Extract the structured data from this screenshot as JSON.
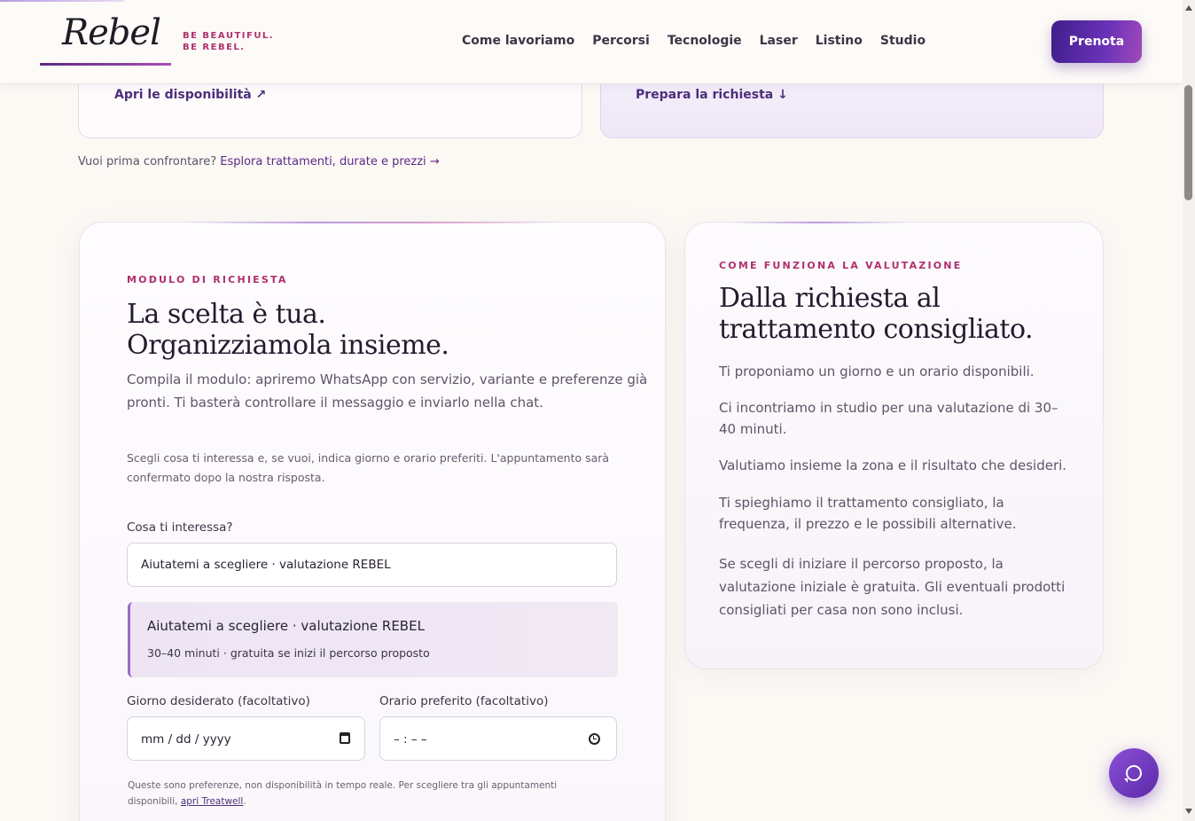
{
  "header": {
    "logo_text": "Rebel",
    "tagline": "BE BEAUTIFUL. BE REBEL.",
    "nav": [
      "Come lavoriamo",
      "Percorsi",
      "Tecnologie",
      "Laser",
      "Listino",
      "Studio"
    ],
    "cta": "Prenota"
  },
  "top_cards": {
    "left_link": "Apri le disponibilità ↗",
    "right_link": "Prepara la richiesta ↓"
  },
  "compare": {
    "prefix": "Vuoi prima confrontare?",
    "link": "Esplora trattamenti, durate e prezzi",
    "arrow": "→"
  },
  "form": {
    "eyebrow": "MODULO DI RICHIESTA",
    "title_line1": "La scelta è tua.",
    "title_line2": "Organizziamola insieme.",
    "lead_line1": "Compila il modulo: apriremo WhatsApp con servizio, variante e preferenze già",
    "lead_line2": "pronti. Ti basterà controllare il messaggio e inviarlo nella chat.",
    "hint_line1": "Scegli cosa ti interessa e, se vuoi, indica giorno e orario preferiti. L'appuntamento sarà",
    "hint_line2": "confermato dopo la nostra risposta.",
    "service_label": "Cosa ti interessa?",
    "service_value": "Aiutatemi a scegliere · valutazione REBEL",
    "selected_title": "Aiutatemi a scegliere · valutazione REBEL",
    "selected_sub": "30–40 minuti · gratuita se inizi il percorso proposto",
    "day_label": "Giorno desiderato (facoltativo)",
    "day_placeholder": "mm / dd / yyyy",
    "time_label": "Orario preferito (facoltativo)",
    "time_placeholder": "– : – –",
    "note_line1": "Queste sono preferenze, non disponibilità in tempo reale. Per scegliere tra gli appuntamenti",
    "note_prefix": "disponibili,",
    "note_link": "apri Treatwell",
    "note_suffix": "."
  },
  "info": {
    "eyebrow": "COME FUNZIONA LA VALUTAZIONE",
    "title_line1": "Dalla richiesta al",
    "title_line2": "trattamento consigliato.",
    "p1": "Ti proponiamo un giorno e un orario disponibili.",
    "p2": "Ci incontriamo in studio per una valutazione di 30–40 minuti.",
    "p3": "Valutiamo insieme la zona e il risultato che desideri.",
    "p4": "Ti spieghiamo il trattamento consigliato, la frequenza, il prezzo e le possibili alternative.",
    "p5": "Se scegli di iniziare il percorso proposto, la valutazione iniziale è gratuita. Gli eventuali prodotti consigliati per casa non sono inclusi."
  },
  "colors": {
    "accent": "#5b2a86",
    "eyebrow": "#b02f6c",
    "background": "#fcf9f5"
  },
  "icons": [
    "calendar-icon",
    "clock-icon",
    "whatsapp-icon",
    "arrow-up-right-icon",
    "arrow-down-icon"
  ]
}
